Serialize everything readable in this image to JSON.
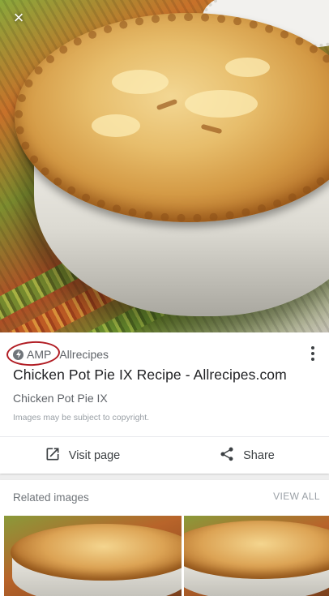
{
  "hero": {
    "alt": "Chicken pot pie in a white dish on a striped green and orange cloth",
    "close_icon": "close-icon"
  },
  "card": {
    "amp_label": "AMP",
    "amp_icon": "amp-bolt-icon",
    "source": "Allrecipes",
    "more_icon": "more-vert-icon",
    "title": "Chicken Pot Pie IX Recipe - Allrecipes.com",
    "subtitle": "Chicken Pot Pie IX",
    "copyright": "Images may be subject to copyright.",
    "annotation_color": "#b11d24"
  },
  "actions": {
    "visit_label": "Visit page",
    "visit_icon": "open-in-new-icon",
    "share_label": "Share",
    "share_icon": "share-icon"
  },
  "related": {
    "title": "Related images",
    "view_all": "VIEW ALL"
  }
}
